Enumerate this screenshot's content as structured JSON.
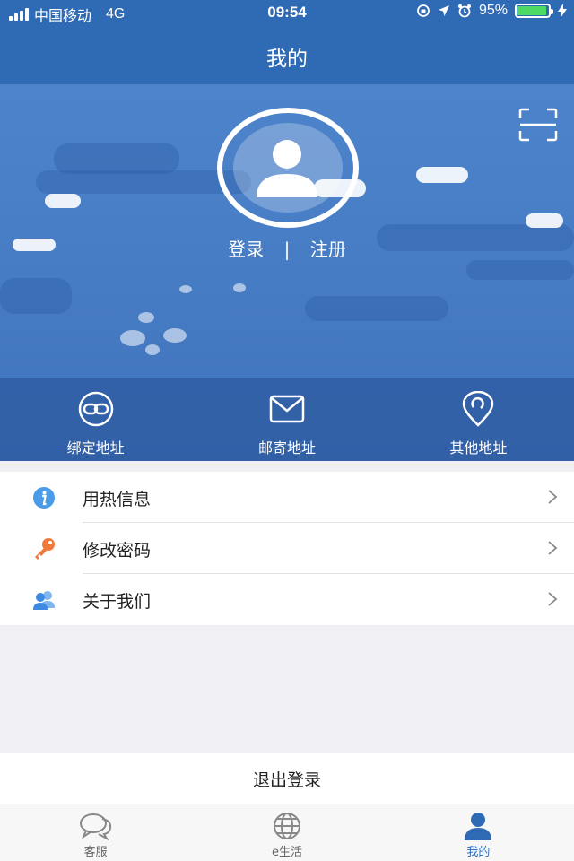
{
  "status_bar": {
    "carrier": "中国移动",
    "network": "4G",
    "time": "09:54",
    "battery": "95%",
    "battery_level": 0.95
  },
  "nav": {
    "title": "我的"
  },
  "profile": {
    "login_label": "登录",
    "separator": "|",
    "register_label": "注册"
  },
  "address_bar": [
    {
      "label": "绑定地址",
      "icon": "link-icon"
    },
    {
      "label": "邮寄地址",
      "icon": "mail-icon"
    },
    {
      "label": "其他地址",
      "icon": "location-pin-icon"
    }
  ],
  "menu": [
    {
      "label": "用热信息",
      "icon": "info-icon"
    },
    {
      "label": "修改密码",
      "icon": "key-icon"
    },
    {
      "label": "关于我们",
      "icon": "users-icon"
    }
  ],
  "logout_label": "退出登录",
  "tabs": [
    {
      "label": "客服",
      "icon": "chat-icon",
      "active": false
    },
    {
      "label": "e生活",
      "icon": "globe-icon",
      "active": false
    },
    {
      "label": "我的",
      "icon": "person-icon",
      "active": true
    }
  ],
  "colors": {
    "primary": "#2f6ab4",
    "header_blue": "#4a80c8",
    "battery_green": "#4cd964",
    "key_orange": "#f07a3c",
    "info_blue": "#4a9be8"
  }
}
